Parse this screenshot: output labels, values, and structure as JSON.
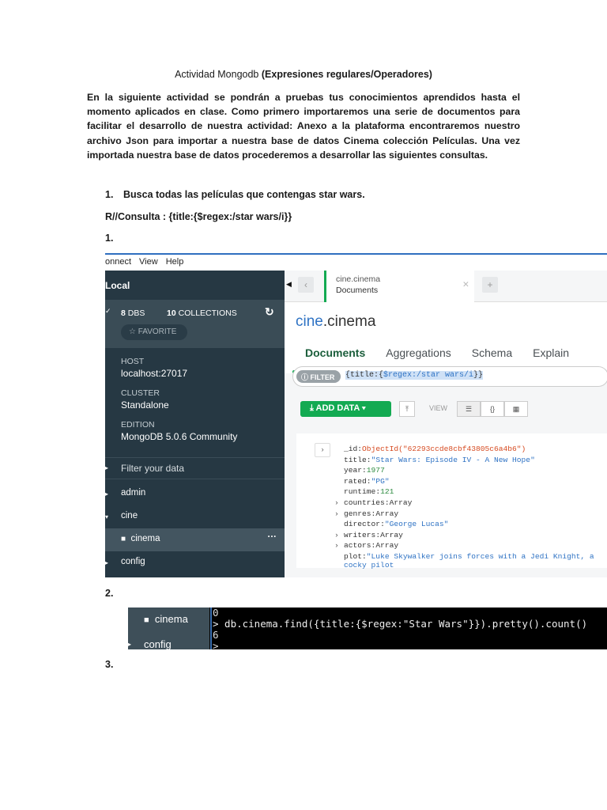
{
  "document": {
    "title_plain": "Actividad Mongodb",
    "title_bold": "(Expresiones regulares/Operadores)",
    "paragraph": "En la siguiente actividad se pondrán a pruebas tus conocimientos aprendidos hasta el momento aplicados en clase. Como primero importaremos una serie de documentos para facilitar el desarrollo de nuestra actividad: Anexo a la plataforma encontraremos nuestro archivo Json para importar a nuestra base de datos Cinema colección Películas. Una vez importada nuestra base de datos procederemos a desarrollar las siguientes consultas.",
    "item1_num": "1.",
    "item1_text": "Busca todas las películas que contengas star wars.",
    "answer": "R//Consulta : {title:{$regex:/star wars/i}}",
    "label1": "1.",
    "label2": "2.",
    "label3": "3."
  },
  "compass": {
    "menu": [
      "onnect",
      "View",
      "Help"
    ],
    "sidebar": {
      "connection": "Local",
      "dbs_count": "8",
      "dbs_label": "DBS",
      "collections_count": "10",
      "collections_label": "COLLECTIONS",
      "favorite": "☆ FAVORITE",
      "host_label": "HOST",
      "host": "localhost:27017",
      "cluster_label": "CLUSTER",
      "cluster": "Standalone",
      "edition_label": "EDITION",
      "edition": "MongoDB 5.0.6 Community",
      "filter_placeholder": "Filter your data",
      "items": [
        "admin",
        "cine",
        "cinema",
        "config"
      ]
    },
    "tab": {
      "ns": "cine.cinema",
      "label": "Documents"
    },
    "header": {
      "db": "cine",
      "coll": ".cinema"
    },
    "tabs": [
      "Documents",
      "Aggregations",
      "Schema",
      "Explain"
    ],
    "filter": {
      "pill": "FILTER",
      "q1": "{title:{",
      "q2": "$regex:/star wars/i",
      "q3": "}}"
    },
    "toolbar": {
      "add_data": "ADD DATA",
      "view": "VIEW"
    },
    "doc": [
      {
        "k": "_id",
        "v": "ObjectId(\"62293ccde8cbf43805c6a4b6\")",
        "t": "o"
      },
      {
        "k": "title",
        "v": "\"Star Wars: Episode IV - A New Hope\"",
        "t": "s"
      },
      {
        "k": "year",
        "v": "1977",
        "t": "n"
      },
      {
        "k": "rated",
        "v": "\"PG\"",
        "t": "s"
      },
      {
        "k": "runtime",
        "v": "121",
        "t": "n"
      },
      {
        "k": "countries",
        "v": "Array",
        "t": "a"
      },
      {
        "k": "genres",
        "v": "Array",
        "t": "a"
      },
      {
        "k": "director",
        "v": "\"George Lucas\"",
        "t": "s"
      },
      {
        "k": "writers",
        "v": "Array",
        "t": "a"
      },
      {
        "k": "actors",
        "v": "Array",
        "t": "a"
      },
      {
        "k": "plot",
        "v": "\"Luke Skywalker joins forces with a Jedi Knight, a cocky pilot",
        "t": "s"
      }
    ]
  },
  "shell": {
    "side_items": [
      "cinema",
      "config"
    ],
    "lines": [
      "0",
      "> db.cinema.find({title:{$regex:\"Star Wars\"}}).pretty().count()",
      "6",
      ">"
    ]
  }
}
